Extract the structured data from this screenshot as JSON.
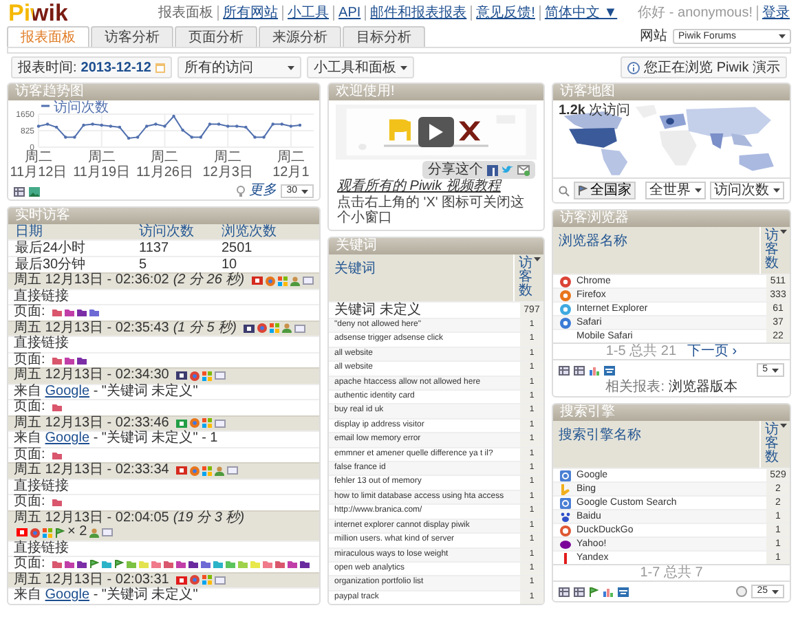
{
  "logo": "Piwik",
  "top_links": [
    {
      "label": "报表面板",
      "kind": "text"
    },
    {
      "label": "所有网站",
      "kind": "link"
    },
    {
      "label": "小工具",
      "kind": "link"
    },
    {
      "label": "API",
      "kind": "link"
    },
    {
      "label": "邮件和报表报表",
      "kind": "link"
    },
    {
      "label": "意见反馈!",
      "kind": "link"
    },
    {
      "label": "简体中文 ▼",
      "kind": "link"
    }
  ],
  "user": {
    "greeting": "你好 - anonymous!",
    "login": "登录"
  },
  "tabs": [
    {
      "label": "报表面板",
      "selected": true
    },
    {
      "label": "访客分析",
      "selected": false
    },
    {
      "label": "页面分析",
      "selected": false
    },
    {
      "label": "来源分析",
      "selected": false
    },
    {
      "label": "目标分析",
      "selected": false
    }
  ],
  "site": {
    "label": "网站",
    "value": "Piwik Forums"
  },
  "toolbar": {
    "date_label": "报表时间:",
    "date": "2013-12-12",
    "segment": "所有的访问",
    "widgets_menu": "小工具和面板",
    "demo_notice": "您正在浏览 Piwik 演示"
  },
  "evolution": {
    "title": "访客趋势图",
    "more": "更多",
    "periods": "30",
    "chart_data": {
      "type": "line",
      "ylim": [
        0,
        1650
      ],
      "yticks": [
        0,
        825,
        1650
      ],
      "categories": [
        "周二 11月12日",
        null,
        null,
        null,
        null,
        null,
        null,
        "周二 11月19日",
        null,
        null,
        null,
        null,
        null,
        null,
        "周二 11月26日",
        null,
        null,
        null,
        null,
        null,
        null,
        "周二 12月3日",
        null,
        null,
        null,
        null,
        null,
        null,
        "周二 12月1",
        null
      ],
      "series": [
        {
          "name": "访问次数",
          "color": "#5170ae",
          "values": [
            1050,
            1150,
            1000,
            500,
            500,
            1100,
            1150,
            1100,
            1050,
            1000,
            450,
            500,
            1050,
            1150,
            1050,
            1550,
            850,
            500,
            500,
            1150,
            1150,
            1050,
            1050,
            1000,
            500,
            500,
            1150,
            1150,
            1050,
            1100
          ]
        }
      ]
    }
  },
  "live": {
    "title": "实时访客",
    "columns": [
      "日期",
      "访问次数",
      "浏览次数"
    ],
    "rows": [
      [
        "最后24小时",
        "1137",
        "2501"
      ],
      [
        "最后30分钟",
        "5",
        "10"
      ]
    ],
    "visits": [
      {
        "time": "周五 12月13日 - 02:36:02",
        "duration": "(2 分 26 秒)",
        "icons": [
          {
            "kind": "flag",
            "color": "#d52b1e"
          },
          {
            "kind": "browser",
            "color": "#e8751a"
          },
          {
            "kind": "os"
          },
          {
            "kind": "visitor"
          },
          {
            "kind": "plugins"
          }
        ],
        "referrer": {
          "kind": "direct",
          "text": "直接链接"
        },
        "pages_label": "页面:",
        "pages": [
          {
            "kind": "page",
            "color": "#d9566d"
          },
          {
            "kind": "page",
            "color": "#c13ea8"
          },
          {
            "kind": "page",
            "color": "#7b2ea6"
          },
          {
            "kind": "page",
            "color": "#6d6ad6"
          }
        ]
      },
      {
        "time": "周五 12月13日 - 02:35:43",
        "duration": "(1 分 5 秒)",
        "icons": [
          {
            "kind": "flag",
            "color": "#3c3b6e"
          },
          {
            "kind": "browser",
            "color": "#db4437"
          },
          {
            "kind": "os"
          },
          {
            "kind": "visitor"
          },
          {
            "kind": "plugins"
          }
        ],
        "referrer": {
          "kind": "direct",
          "text": "直接链接"
        },
        "pages_label": "页面:",
        "pages": [
          {
            "kind": "page",
            "color": "#d9566d"
          },
          {
            "kind": "page",
            "color": "#c13ea8"
          },
          {
            "kind": "page",
            "color": "#7b2ea6"
          }
        ]
      },
      {
        "time": "周五 12月13日 - 02:34:30",
        "icons": [
          {
            "kind": "flag",
            "color": "#3c3b6e"
          },
          {
            "kind": "browser",
            "color": "#db4437"
          },
          {
            "kind": "os"
          },
          {
            "kind": "plugins"
          }
        ],
        "referrer": {
          "kind": "search",
          "prefix": "来自",
          "link": "Google",
          "text": "- \"关键词 未定义\""
        },
        "pages_label": "页面:",
        "pages": [
          {
            "kind": "page",
            "color": "#d9566d"
          }
        ]
      },
      {
        "time": "周五 12月13日 - 02:33:46",
        "icons": [
          {
            "kind": "flag",
            "color": "#229e45"
          },
          {
            "kind": "browser",
            "color": "#e8751a"
          },
          {
            "kind": "os"
          },
          {
            "kind": "plugins"
          }
        ],
        "referrer": {
          "kind": "search",
          "prefix": "来自",
          "link": "Google",
          "text": "- \"关键词 未定义\" - 1"
        },
        "pages_label": "页面:",
        "pages": [
          {
            "kind": "page",
            "color": "#d9566d"
          }
        ]
      },
      {
        "time": "周五 12月13日 - 02:33:34",
        "icons": [
          {
            "kind": "flag",
            "color": "#d52b1e"
          },
          {
            "kind": "browser",
            "color": "#e8751a"
          },
          {
            "kind": "os"
          },
          {
            "kind": "visitor"
          },
          {
            "kind": "plugins"
          }
        ],
        "referrer": {
          "kind": "direct",
          "text": "直接链接"
        },
        "pages_label": "页面:",
        "pages": [
          {
            "kind": "page",
            "color": "#d9566d"
          }
        ]
      },
      {
        "time": "周五 12月13日 - 02:04:05",
        "duration": "(19 分 3 秒)",
        "icons": [
          {
            "kind": "flag",
            "color": "#fe0000"
          },
          {
            "kind": "browser",
            "color": "#db4437"
          },
          {
            "kind": "os"
          },
          {
            "kind": "goal",
            "count": "× 2"
          },
          {
            "kind": "visitor"
          },
          {
            "kind": "plugins"
          }
        ],
        "referrer": {
          "kind": "direct",
          "text": "直接链接"
        },
        "pages_label": "页面:",
        "pages": [
          {
            "kind": "page",
            "color": "#d9566d"
          },
          {
            "kind": "page",
            "color": "#c13ea8"
          },
          {
            "kind": "page",
            "color": "#7b2ea6"
          },
          {
            "kind": "goal"
          },
          {
            "kind": "page",
            "color": "#2bb3c8"
          },
          {
            "kind": "goal"
          },
          {
            "kind": "page",
            "color": "#7cc242"
          },
          {
            "kind": "page",
            "color": "#e3e34f"
          },
          {
            "kind": "page",
            "color": "#f07a8a"
          },
          {
            "kind": "page",
            "color": "#d9566d"
          },
          {
            "kind": "page",
            "color": "#c13ea8"
          },
          {
            "kind": "page",
            "color": "#6a2a9e"
          },
          {
            "kind": "page",
            "color": "#6d6ad6"
          },
          {
            "kind": "page",
            "color": "#2bb3c8"
          },
          {
            "kind": "page",
            "color": "#5cc45c"
          },
          {
            "kind": "page",
            "color": "#9ed24a"
          },
          {
            "kind": "page",
            "color": "#e8e84a"
          },
          {
            "kind": "page",
            "color": "#f07a8a"
          },
          {
            "kind": "page",
            "color": "#d9566c"
          },
          {
            "kind": "page",
            "color": "#c13ea9"
          },
          {
            "kind": "page",
            "color": "#6a2a9f"
          }
        ]
      },
      {
        "time": "周五 12月13日 - 02:03:31",
        "icons": [
          {
            "kind": "flag",
            "color": "#e11b1b"
          },
          {
            "kind": "browser",
            "color": "#db4437"
          },
          {
            "kind": "os"
          },
          {
            "kind": "plugins"
          }
        ],
        "referrer": {
          "kind": "search",
          "prefix": "来自",
          "link": "Google",
          "text": "- \"关键词 未定义\""
        }
      }
    ]
  },
  "welcome": {
    "title": "欢迎使用!",
    "share": "分享这个",
    "link": "观看所有的 Piwik 视频教程",
    "note": "点击右上角的 'X' 图标可关闭这个小窗口"
  },
  "keywords": {
    "title": "关键词",
    "columns": [
      "关键词",
      "访客数"
    ],
    "rows": [
      {
        "label": "关键词 未定义",
        "value": "797"
      },
      {
        "label": "\"deny not allowed here\"",
        "value": "1"
      },
      {
        "label": "adsense trigger adsense click",
        "value": "1"
      },
      {
        "label": "all website",
        "value": "1"
      },
      {
        "label": "all website",
        "value": "1"
      },
      {
        "label": "apache htaccess allow not allowed here",
        "value": "1"
      },
      {
        "label": "authentic identity card",
        "value": "1"
      },
      {
        "label": "buy real id uk",
        "value": "1"
      },
      {
        "label": "display ip address visitor",
        "value": "1"
      },
      {
        "label": "email low memory error",
        "value": "1"
      },
      {
        "label": "emmner et amener quelle difference ya t il?",
        "value": "1"
      },
      {
        "label": "false france id",
        "value": "1"
      },
      {
        "label": "fehler 13 out of memory",
        "value": "1"
      },
      {
        "label": "how to limit database access using hta access",
        "value": "1"
      },
      {
        "label": "http://www.branica.com/",
        "value": "1"
      },
      {
        "label": "internet explorer cannot display piwik",
        "value": "1"
      },
      {
        "label": "million users. what kind of server",
        "value": "1"
      },
      {
        "label": "miraculous ways to lose weight",
        "value": "1"
      },
      {
        "label": "open web analytics",
        "value": "1"
      },
      {
        "label": "organization portfolio list",
        "value": "1"
      },
      {
        "label": "paypal track",
        "value": "1"
      }
    ]
  },
  "map": {
    "title": "访客地图",
    "visits": "**1.2k** 次访问",
    "countries_button": "全国家",
    "region": "全世界",
    "metric": "访问次数"
  },
  "browsers": {
    "title": "访客浏览器",
    "columns": [
      "浏览器名称",
      "访客数"
    ],
    "rows": [
      {
        "kind": "chrome",
        "name": "Chrome",
        "value": "511"
      },
      {
        "kind": "firefox",
        "name": "Firefox",
        "value": "333"
      },
      {
        "kind": "ie",
        "name": "Internet Explorer",
        "value": "61"
      },
      {
        "kind": "safari",
        "name": "Safari",
        "value": "37"
      },
      {
        "kind": "plain",
        "name": "Mobile Safari",
        "value": "22"
      }
    ],
    "pagination": "1-5 总共 21",
    "next": "下一页 ›",
    "limit": "5",
    "related_label": "相关报表:",
    "related_link": "浏览器版本"
  },
  "search_engines": {
    "title": "搜索引擎",
    "columns": [
      "搜索引擎名称",
      "访客数"
    ],
    "rows": [
      {
        "kind": "google",
        "name": "Google",
        "value": "529"
      },
      {
        "kind": "bing",
        "name": "Bing",
        "value": "2"
      },
      {
        "kind": "google",
        "name": "Google Custom Search",
        "value": "2"
      },
      {
        "kind": "baidu",
        "name": "Baidu",
        "value": "1"
      },
      {
        "kind": "duckduckgo",
        "name": "DuckDuckGo",
        "value": "1"
      },
      {
        "kind": "yahoo",
        "name": "Yahoo!",
        "value": "1"
      },
      {
        "kind": "yandex",
        "name": "Yandex",
        "value": "1"
      }
    ],
    "pagination": "1-7 总共 7",
    "limit": "25"
  }
}
